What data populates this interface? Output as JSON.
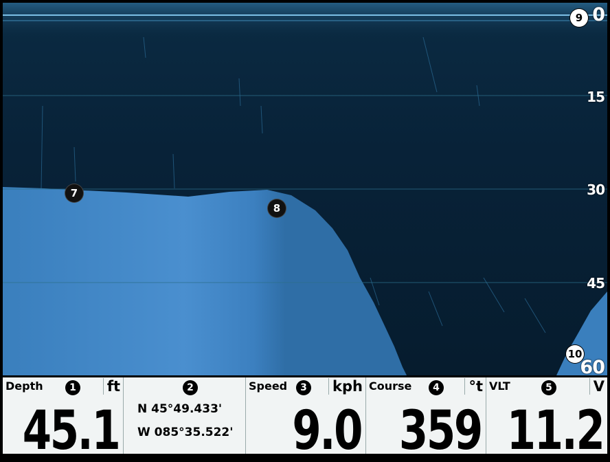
{
  "sonar": {
    "depth_scale": [
      "0",
      "15",
      "30",
      "45",
      "60"
    ],
    "markers": [
      "7",
      "8",
      "9",
      "10"
    ],
    "colors": {
      "water": "#072236",
      "bottom": "#3f86c7",
      "surface": "#2b6e98",
      "grid": "#2b6f8a"
    }
  },
  "panel": {
    "depth": {
      "label": "Depth",
      "unit": "ft",
      "value": "45.1",
      "num": "1"
    },
    "position": {
      "num": "2",
      "lat": "N 45°49.433'",
      "lon": "W 085°35.522'"
    },
    "speed": {
      "label": "Speed",
      "unit": "kph",
      "value": "9.0",
      "num": "3"
    },
    "course": {
      "label": "Course",
      "unit": "°t",
      "value": "359",
      "num": "4"
    },
    "voltage": {
      "label": "VLT",
      "unit": "V",
      "value": "11.2",
      "num": "5"
    }
  }
}
